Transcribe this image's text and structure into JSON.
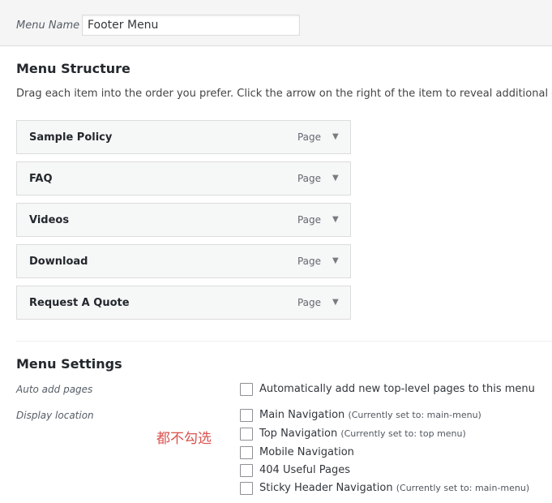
{
  "menu_name": {
    "label": "Menu Name",
    "value": "Footer Menu"
  },
  "structure": {
    "title": "Menu Structure",
    "instructions": "Drag each item into the order you prefer. Click the arrow on the right of the item to reveal additional configuration options.",
    "items": [
      {
        "title": "Sample Policy",
        "type": "Page"
      },
      {
        "title": "FAQ",
        "type": "Page"
      },
      {
        "title": "Videos",
        "type": "Page"
      },
      {
        "title": "Download",
        "type": "Page"
      },
      {
        "title": "Request A Quote",
        "type": "Page"
      }
    ],
    "toggle_glyph": "▼"
  },
  "settings": {
    "title": "Menu Settings",
    "auto_add_label": "Auto add pages",
    "auto_add_option": "Automatically add new top-level pages to this menu",
    "display_location_label": "Display location",
    "locations": [
      {
        "name": "Main Navigation",
        "note": "(Currently set to: main-menu)"
      },
      {
        "name": "Top Navigation",
        "note": "(Currently set to: top menu)"
      },
      {
        "name": "Mobile Navigation",
        "note": ""
      },
      {
        "name": "404 Useful Pages",
        "note": ""
      },
      {
        "name": "Sticky Header Navigation",
        "note": "(Currently set to: main-menu)"
      }
    ]
  },
  "annotation": "都不勾选",
  "colors": {
    "annotation": "#d9534f",
    "item_background": "#f6f7f7",
    "border": "#dcdcde"
  }
}
